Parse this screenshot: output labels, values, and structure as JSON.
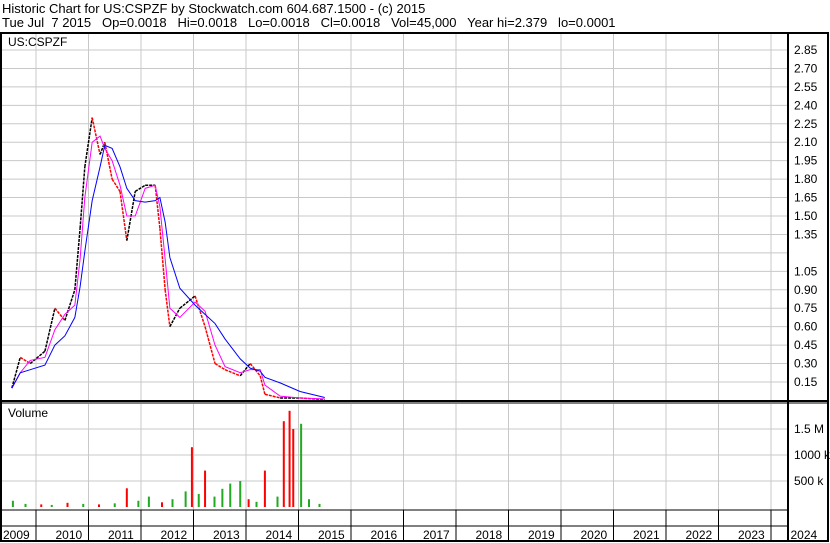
{
  "header": {
    "line1": "Historic Chart for US:CSPZF by Stockwatch.com 604.687.1500 - (c) 2015",
    "line2": "Tue Jul  7 2015   Op=0.0018   Hi=0.0018   Lo=0.0018   Cl=0.0018   Vol=45,000   Year hi=2.379   lo=0.0001"
  },
  "chart_data": {
    "type": "line",
    "title": "US:CSPZF",
    "volume_title": "Volume",
    "colors": {
      "price": "#000000",
      "price_down": "#ff0000",
      "ma_short": "#ff00ff",
      "ma_long": "#0000ff",
      "vol_up": "#22aa22",
      "vol_down": "#ff0000"
    },
    "price_ticks": [
      "0.15",
      "0.30",
      "0.45",
      "0.60",
      "0.75",
      "0.90",
      "1.05",
      "1.35",
      "1.50",
      "1.65",
      "1.80",
      "1.95",
      "2.10",
      "2.25",
      "2.40",
      "2.55",
      "2.70",
      "2.85"
    ],
    "price_tick_values": [
      0.15,
      0.3,
      0.45,
      0.6,
      0.75,
      0.9,
      1.05,
      1.35,
      1.5,
      1.65,
      1.8,
      1.95,
      2.1,
      2.25,
      2.4,
      2.55,
      2.7,
      2.85
    ],
    "ylim": [
      0,
      3.0
    ],
    "volume_ticks": [
      "500 k",
      "1000 k",
      "1.5 M"
    ],
    "volume_tick_values": [
      500000,
      1000000,
      1500000
    ],
    "x_ticks": [
      "2009",
      "2010",
      "2011",
      "2012",
      "2013",
      "2014",
      "2015",
      "2016",
      "2017",
      "2018",
      "2019",
      "2020",
      "2021",
      "2022",
      "2023",
      "2024"
    ],
    "price": {
      "x": [
        2009.54,
        2009.7,
        2009.89,
        2010.17,
        2010.36,
        2010.55,
        2010.74,
        2010.84,
        2010.93,
        2011.07,
        2011.22,
        2011.31,
        2011.45,
        2011.6,
        2011.73,
        2011.89,
        2012.08,
        2012.27,
        2012.36,
        2012.46,
        2012.55,
        2012.74,
        2013.03,
        2013.22,
        2013.41,
        2013.6,
        2013.89,
        2014.08,
        2014.27,
        2014.36,
        2014.65,
        2015.03,
        2015.5
      ],
      "y": [
        0.1,
        0.35,
        0.3,
        0.4,
        0.75,
        0.65,
        0.9,
        1.4,
        1.9,
        2.3,
        2.0,
        2.1,
        1.8,
        1.7,
        1.3,
        1.7,
        1.75,
        1.75,
        1.4,
        0.9,
        0.6,
        0.75,
        0.85,
        0.6,
        0.3,
        0.25,
        0.2,
        0.3,
        0.2,
        0.05,
        0.02,
        0.02,
        0.005
      ]
    },
    "volume": {
      "x": [
        2009.56,
        2009.8,
        2010.1,
        2010.3,
        2010.6,
        2010.9,
        2011.2,
        2011.5,
        2011.73,
        2011.95,
        2012.15,
        2012.4,
        2012.6,
        2012.85,
        2012.97,
        2013.1,
        2013.22,
        2013.4,
        2013.55,
        2013.7,
        2013.89,
        2014.05,
        2014.2,
        2014.36,
        2014.6,
        2014.72,
        2014.83,
        2014.9,
        2015.05,
        2015.2,
        2015.4
      ],
      "y": [
        120000,
        60000,
        50000,
        40000,
        80000,
        60000,
        50000,
        70000,
        360000,
        120000,
        200000,
        90000,
        150000,
        300000,
        1150000,
        250000,
        700000,
        200000,
        350000,
        450000,
        500000,
        150000,
        100000,
        700000,
        200000,
        1650000,
        1850000,
        1500000,
        1600000,
        150000,
        60000
      ],
      "up": [
        true,
        true,
        false,
        true,
        false,
        true,
        false,
        true,
        false,
        true,
        true,
        false,
        true,
        true,
        false,
        true,
        false,
        true,
        true,
        true,
        true,
        false,
        true,
        false,
        true,
        false,
        false,
        false,
        true,
        true,
        true
      ]
    }
  }
}
